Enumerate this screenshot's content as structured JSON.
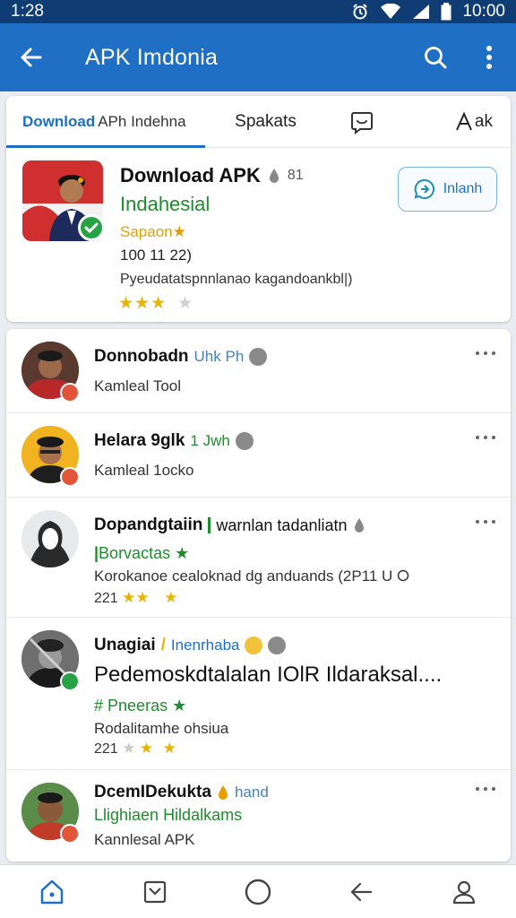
{
  "status": {
    "time": "1:28",
    "clock": "10:00"
  },
  "appbar": {
    "title": "APK Imdonia"
  },
  "tabs": [
    {
      "label": "Download",
      "sub": "APh Indehna"
    },
    {
      "label": "Spakats"
    },
    {
      "label": ""
    },
    {
      "label": "ak"
    }
  ],
  "featured": {
    "title": "Download APK",
    "title_extra": "81",
    "subtitle": "Indahesial",
    "category": "Sapaon",
    "size": "100 11 22)",
    "description": "Pyeudatatspnnlanao kagandoankbl|)",
    "rating": 3,
    "button_label": "Inlanh"
  },
  "colors": {
    "primary": "#1f6fc4",
    "status_bar": "#0f3d73",
    "green": "#1e8c2c",
    "star": "#e8b400",
    "badge_red": "#e2553a",
    "badge_green": "#27a244"
  },
  "rows": [
    {
      "title": "Donnobadn",
      "tag": "Uhk Ph",
      "sub": "Kamleal Tool"
    },
    {
      "title": "Helara 9glk",
      "tag": "1 Jwh",
      "sub": "Kamleal 1ocko"
    },
    {
      "title": "Dopandgtaiin",
      "tag": "warnlan tadanliatn",
      "green": "Borvactas",
      "sub": "Korokanoe cealoknad dg anduands (2P11 U",
      "num": "221"
    },
    {
      "title": "Unagiai",
      "tag": "Inenrhaba",
      "big": "Pedemoskdtalalan IOlR Ildaraksal....",
      "green": "Pneeras",
      "sub": "Rodalitamhe ohsiua",
      "num": "221"
    },
    {
      "title": "DcemIDekukta",
      "tag": "hand",
      "green": "Llighiaen Hildalkams",
      "sub": "Kannlesal APK"
    }
  ]
}
